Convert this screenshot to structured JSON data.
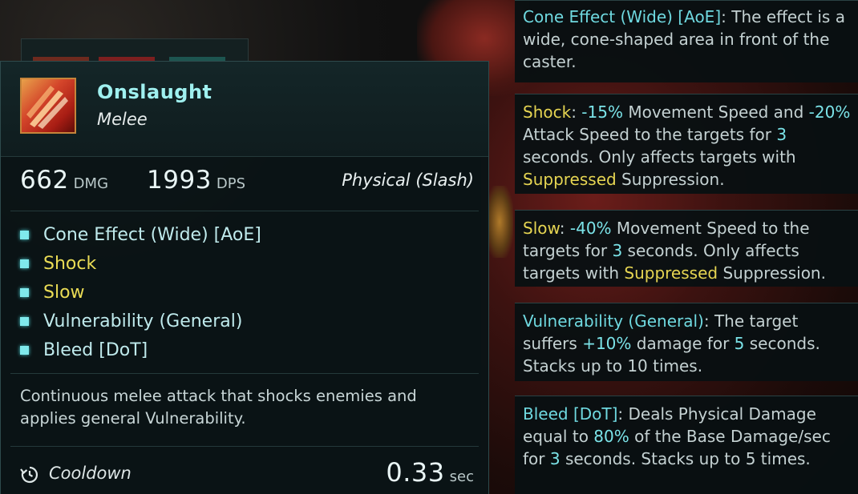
{
  "hotbar": {
    "slots": [
      "#6e2a1e",
      "#7d1f1f",
      "#1d5550"
    ]
  },
  "ability": {
    "name": "Onslaught",
    "type": "Melee",
    "icon": "slash-icon",
    "damage": {
      "value": "662",
      "unit": "DMG"
    },
    "dps": {
      "value": "1993",
      "unit": "DPS"
    },
    "damage_type": "Physical (Slash)",
    "effects": [
      {
        "label": "Cone Effect (Wide) [AoE]",
        "color": "#bfeaec"
      },
      {
        "label": "Shock",
        "color": "#eadc55"
      },
      {
        "label": "Slow",
        "color": "#eadc55"
      },
      {
        "label": "Vulnerability (General)",
        "color": "#bfeaec"
      },
      {
        "label": "Bleed [DoT]",
        "color": "#bfeaec"
      }
    ],
    "description": "Continuous melee attack that shocks enemies and applies general Vulnerability.",
    "cooldown": {
      "label": "Cooldown",
      "value": "0.33",
      "unit": "sec"
    }
  },
  "info_panels": {
    "cone": {
      "keyword": "Cone Effect (Wide) [AoE]",
      "text": ": The effect is a wide, cone-shaped area in front of the caster."
    },
    "shock": {
      "keyword": "Shock",
      "t1": ": ",
      "v1": "-15%",
      "t2": " Movement Speed and ",
      "v2": "-20%",
      "t3": " Attack Speed to the targets for ",
      "v3": "3",
      "t4": " seconds. Only affects targets with ",
      "sup": "Suppressed",
      "t5": " Suppression."
    },
    "slow": {
      "keyword": "Slow",
      "t1": ": ",
      "v1": "-40%",
      "t2": " Movement Speed to the targets for ",
      "v2": "3",
      "t3": " seconds. Only affects targets with ",
      "sup": "Suppressed",
      "t4": " Suppression."
    },
    "vuln": {
      "keyword": "Vulnerability (General)",
      "t1": ": The target suffers ",
      "v1": "+10%",
      "t2": " damage for ",
      "v2": "5",
      "t3": " seconds. Stacks up to 10 times."
    },
    "bleed": {
      "keyword": "Bleed [DoT]",
      "t1": ": Deals Physical Damage equal to ",
      "v1": "80%",
      "t2": " of the Base Damage/sec for ",
      "v2": "3",
      "t3": " seconds. Stacks up to 5 times."
    }
  },
  "colors": {
    "accent_cyan": "#7be3e8",
    "keyword_yellow": "#e6d552",
    "title_cyan": "#9ff0ef"
  }
}
